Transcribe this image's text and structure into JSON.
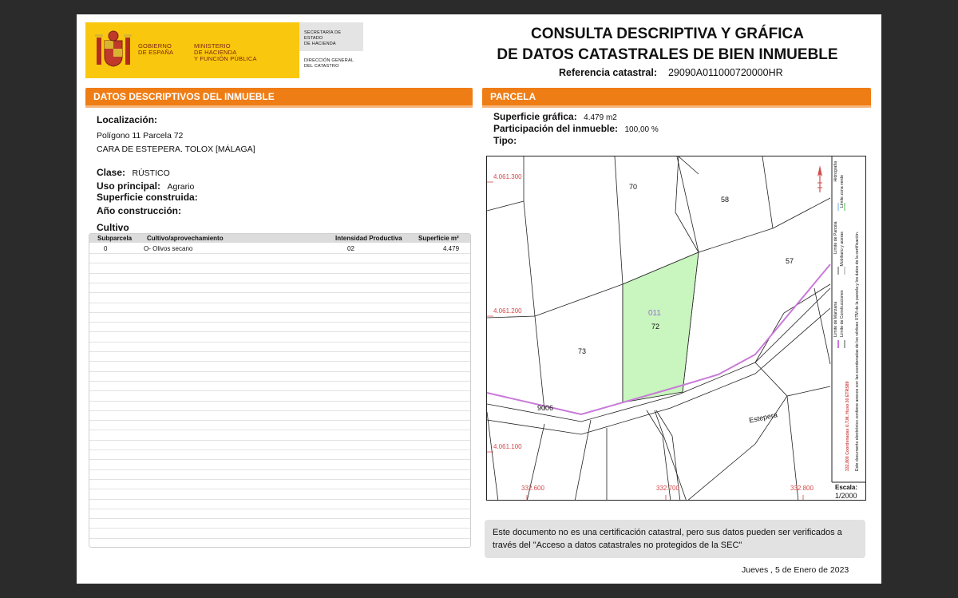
{
  "header": {
    "gov_line1": "GOBIERNO",
    "gov_line2": "DE ESPAÑA",
    "ministry_line1": "MINISTERIO",
    "ministry_line2": "DE HACIENDA",
    "ministry_line3": "Y FUNCIÓN PÚBLICA",
    "secretaria_line1": "SECRETARÍA DE ESTADO",
    "secretaria_line2": "DE HACIENDA",
    "direccion_line1": "DIRECCIÓN GENERAL",
    "direccion_line2": "DEL CATASTRO",
    "title_line1": "CONSULTA DESCRIPTIVA Y GRÁFICA",
    "title_line2": "DE DATOS CATASTRALES DE BIEN INMUEBLE",
    "ref_label": "Referencia catastral:",
    "ref_value": "29090A011000720000HR"
  },
  "left": {
    "section_title": "DATOS DESCRIPTIVOS DEL INMUEBLE",
    "localizacion_label": "Localización:",
    "address_line1": "Polígono 11 Parcela 72",
    "address_line2": "CARA DE ESTEPERA. TOLOX [MÁLAGA]",
    "clase_label": "Clase:",
    "clase_value": "RÚSTICO",
    "uso_label": "Uso principal:",
    "uso_value": "Agrario",
    "superficie_construida_label": "Superficie construida:",
    "anio_label": "Año construcción:",
    "cultivo_title": "Cultivo",
    "table": {
      "headers": [
        "Subparcela",
        "Cultivo/aprovechamiento",
        "Intensidad Productiva",
        "Superficie m²"
      ],
      "rows": [
        [
          "0",
          "O- Olivos secano",
          "02",
          "4.479"
        ]
      ]
    }
  },
  "right": {
    "section_title": "PARCELA",
    "superficie_grafica_label": "Superficie gráfica:",
    "superficie_grafica_value": "4.479 m2",
    "participacion_label": "Participación del inmueble:",
    "participacion_value": "100,00 %",
    "tipo_label": "Tipo:",
    "map": {
      "y_labels": [
        "4.061.300",
        "4.061.200",
        "4.061.100"
      ],
      "x_labels": [
        "332.600",
        "332.700",
        "332.800"
      ],
      "parcel_labels": [
        "70",
        "58",
        "57",
        "73",
        "72"
      ],
      "selected_code": "011",
      "road_label": "9006",
      "place_label": "Estepera",
      "legend_lines": [
        "Límite de Manzana",
        "Límite de Parcela",
        "Límite de Construcciones",
        "Mobiliario y aceras",
        "Límite zona verde",
        "Hidrografía"
      ],
      "coord_note": "332.800 Coordenadas U.T.M. Huso 30 ETRS89",
      "doc_note": "Este documento electrónico contiene anexos con las coordenadas de los vértices UTM de la parcela y los datos de la certificación.",
      "scale_label": "Escala:",
      "scale_value": "1/2000",
      "colors": {
        "parcel_fill": "#c9f5bf",
        "road_line": "#c87ad8",
        "coord_text": "#d24a4a"
      }
    }
  },
  "notice": "Este documento no es una certificación catastral, pero sus datos pueden ser verificados a través del \"Acceso a datos catastrales no protegidos de la SEC\"",
  "date": "Jueves , 5 de Enero de 2023"
}
